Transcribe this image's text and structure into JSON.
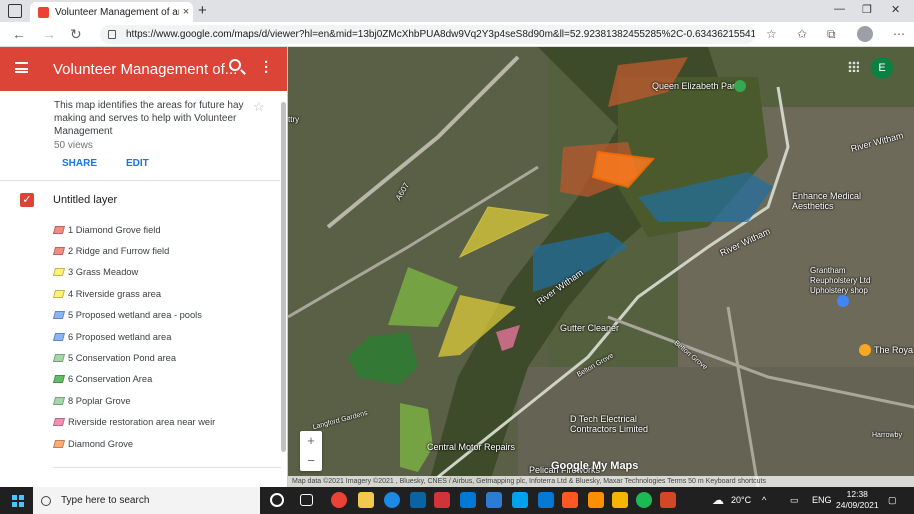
{
  "browser": {
    "tab_title": "Volunteer Management of areas",
    "tab_close": "×",
    "new_tab": "+",
    "url": "https://www.google.com/maps/d/viewer?hl=en&mid=13bj0ZMcXhbPUA8dw9Vq2Y3p4seS8d90m&ll=52.92381382455285%2C-0.6343621554183909&..."
  },
  "panel": {
    "title": "Volunteer Management of...",
    "description": "This map identifies the areas for future hay making and serves to help with Volunteer Management",
    "views": "50 views",
    "share": "SHARE",
    "edit": "EDIT",
    "layer_check": "✓",
    "layer_name": "Untitled layer",
    "items": [
      {
        "label": "1 Diamond Grove field",
        "color": "#f28b82"
      },
      {
        "label": "2 Ridge and Furrow field",
        "color": "#f28b82"
      },
      {
        "label": "3 Grass Meadow",
        "color": "#fff176"
      },
      {
        "label": "4 Riverside grass area",
        "color": "#fff176"
      },
      {
        "label": "5 Proposed wetland area - pools",
        "color": "#8ab4f8"
      },
      {
        "label": "6 Proposed wetland area",
        "color": "#8ab4f8"
      },
      {
        "label": "5 Conservation Pond area",
        "color": "#a5d6a7"
      },
      {
        "label": "6 Conservation Area",
        "color": "#66bb6a"
      },
      {
        "label": "8 Poplar Grove",
        "color": "#a5d6a7"
      },
      {
        "label": "Riverside restoration area near weir",
        "color": "#f48fb1"
      },
      {
        "label": "Diamond Grove",
        "color": "#ffab76"
      }
    ]
  },
  "map": {
    "avatar_letter": "E",
    "zoom_in": "+",
    "zoom_out": "−",
    "google_logo": "Google My Maps",
    "attribution": "Map data ©2021 Imagery ©2021 , Bluesky, CNES / Airbus, Getmapping plc, Infoterra Ltd & Bluesky, Maxar Technologies   Terms   50 m          Keyboard shortcuts",
    "labels": {
      "queen_elizabeth_park": "Queen Elizabeth Park",
      "river_witham_1": "River Witham",
      "river_witham_2": "River Witham",
      "river_witham_3": "River Witham",
      "enhance_medical": "Enhance Medical\nAesthetics",
      "grantham_upholstery": "Grantham\nReupholstery Ltd\nUpholstery shop",
      "the_royal": "The Roya",
      "gutter_cleaner": "Gutter Cleaner",
      "d_tech": "D Tech Electrical\nContractors Limited",
      "central_motor": "Central Motor Repairs",
      "pelican": "Pelican Fireworks",
      "belton_grove_1": "Belton Grove",
      "belton_grove_2": "Belton Grove",
      "langford_gardens": "Langford Gardens",
      "a607": "A607",
      "harrowby": "Harrowby",
      "ttry": "ttry"
    }
  },
  "taskbar": {
    "search_placeholder": "Type here to search",
    "weather": "20°C",
    "lang": "ENG",
    "time": "12:38",
    "date": "24/09/2021"
  }
}
